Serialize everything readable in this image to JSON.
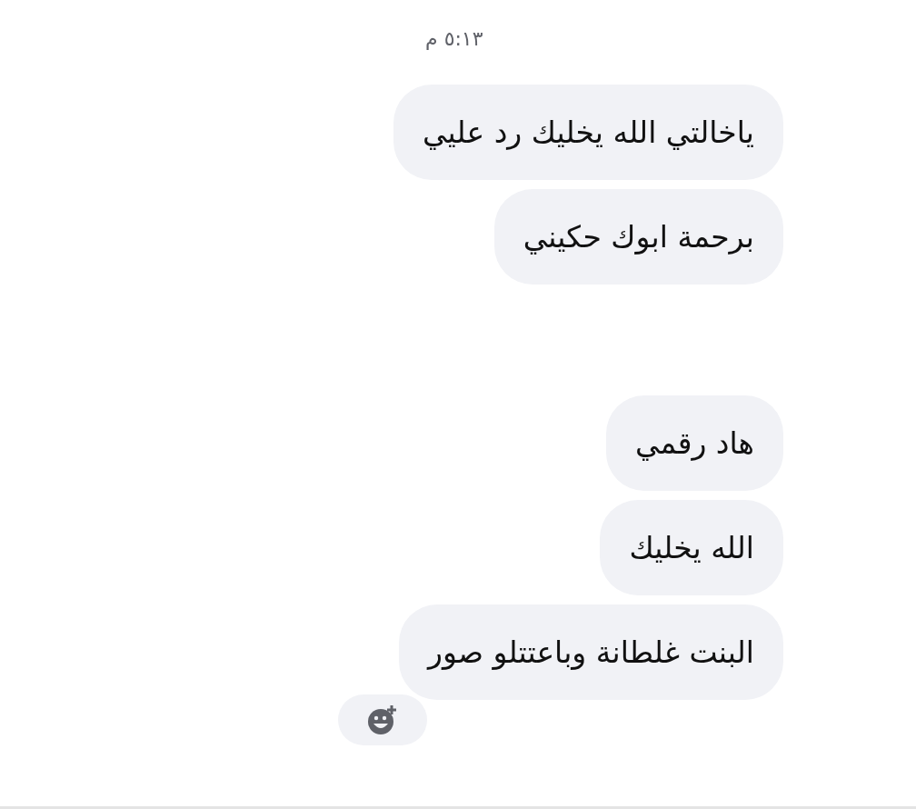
{
  "timestamp": "٥:١٣ م",
  "messages": [
    {
      "kind": "text",
      "text": "ياخالتي الله يخليك رد عليي"
    },
    {
      "kind": "text",
      "text": "برحمة ابوك حكيني"
    },
    {
      "kind": "hidden"
    },
    {
      "kind": "text",
      "text": "هاد رقمي"
    },
    {
      "kind": "text",
      "text": "الله يخليك"
    },
    {
      "kind": "text",
      "text": "البنت غلطانة وباعتتلو صور"
    }
  ]
}
